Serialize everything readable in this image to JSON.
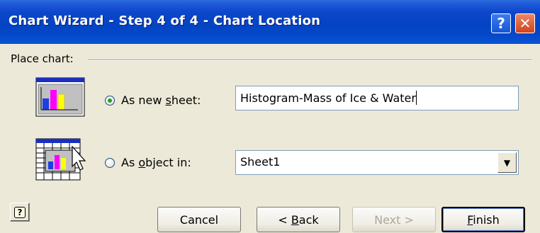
{
  "window": {
    "title": "Chart Wizard - Step 4 of 4 - Chart Location",
    "help_glyph": "?",
    "close_glyph": "✕"
  },
  "group": {
    "label": "Place chart:"
  },
  "options": {
    "new_sheet": {
      "label_pre": "As new ",
      "label_key": "s",
      "label_post": "heet:",
      "checked": true,
      "value": "Histogram-Mass of Ice & Water"
    },
    "object_in": {
      "label_pre": "As ",
      "label_key": "o",
      "label_post": "bject in:",
      "checked": false,
      "value": "Sheet1",
      "arrow": "▼"
    }
  },
  "buttons": {
    "help_glyph": "?",
    "cancel": "Cancel",
    "back_pre": "< ",
    "back_key": "B",
    "back_post": "ack",
    "next": "Next >",
    "finish_key": "F",
    "finish_post": "inish"
  },
  "icons": {
    "sheet_icon": "new-sheet-chart-icon",
    "object_icon": "embedded-chart-icon",
    "cursor": "mouse-pointer-icon"
  },
  "colors": {
    "titlebar": "#0344c4",
    "dialog_bg": "#ece9d8",
    "close_btn": "#d2411c",
    "bar_blue": "#1f3fe0",
    "bar_magenta": "#ff00ff",
    "bar_yellow": "#ffff00"
  }
}
